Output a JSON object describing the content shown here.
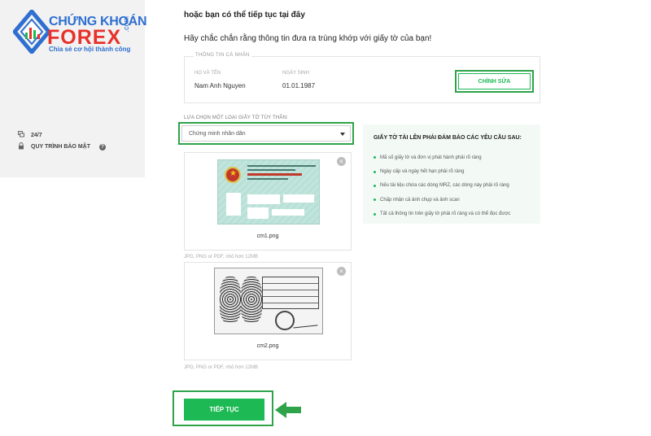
{
  "brand": {
    "top": "CHỨNG KHOÁN",
    "main": "FOREX",
    "domain": ".com",
    "tagline": "Chia sẻ cơ hội thành công",
    "colors": {
      "blue": "#2e6fd0",
      "red": "#e8312a",
      "green": "#1db954"
    }
  },
  "sidebar": {
    "items": [
      {
        "label": "24/7",
        "icon": "chat-icon"
      },
      {
        "label": "QUY TRÌNH BẢO MẬT",
        "icon": "lock-icon",
        "help_icon": "?"
      }
    ]
  },
  "main": {
    "heading": "hoặc bạn có thể tiếp tục tại đây",
    "subheading": "Hãy chắc chắn rằng thông tin đưa ra trùng khớp với giấy tờ của bạn!"
  },
  "personal_info": {
    "title": "THÔNG TIN CÁ NHÂN",
    "name_label": "HỌ VÀ TÊN",
    "name_value": "Nam Anh Nguyen",
    "dob_label": "NGÀY SINH",
    "dob_value": "01.01.1987",
    "edit_button": "CHỈNH SỬA"
  },
  "id_type": {
    "label": "LỰA CHỌN MỘT LOẠI GIẤY TỜ TÙY THÂN:",
    "selected": "Chứng minh nhân dân"
  },
  "uploads": [
    {
      "file_name": "cm1.png",
      "hint": "JPG, PNG or PDF, nhỏ hơn 12MB",
      "remove_icon": "×"
    },
    {
      "file_name": "cm2.png",
      "hint": "JPG, PNG or PDF, nhỏ hơn 12MB",
      "remove_icon": "×"
    }
  ],
  "requirements": {
    "title": "GIẤY TỜ TẢI LÊN PHẢI ĐẢM BẢO CÁC YÊU CẦU SAU:",
    "items": [
      "Mã số giấy tờ và đơn vị phát hành phải rõ ràng",
      "Ngày cấp và ngày hết hạn phải rõ ràng",
      "Nếu tài liệu chứa các dòng MRZ, các dòng này phải rõ ràng",
      "Chấp nhận cả ảnh chụp và ảnh scan",
      "Tất cả thông tin trên giấy tờ phải rõ ràng và có thể đọc được"
    ]
  },
  "continue_button": "TIẾP TỤC"
}
